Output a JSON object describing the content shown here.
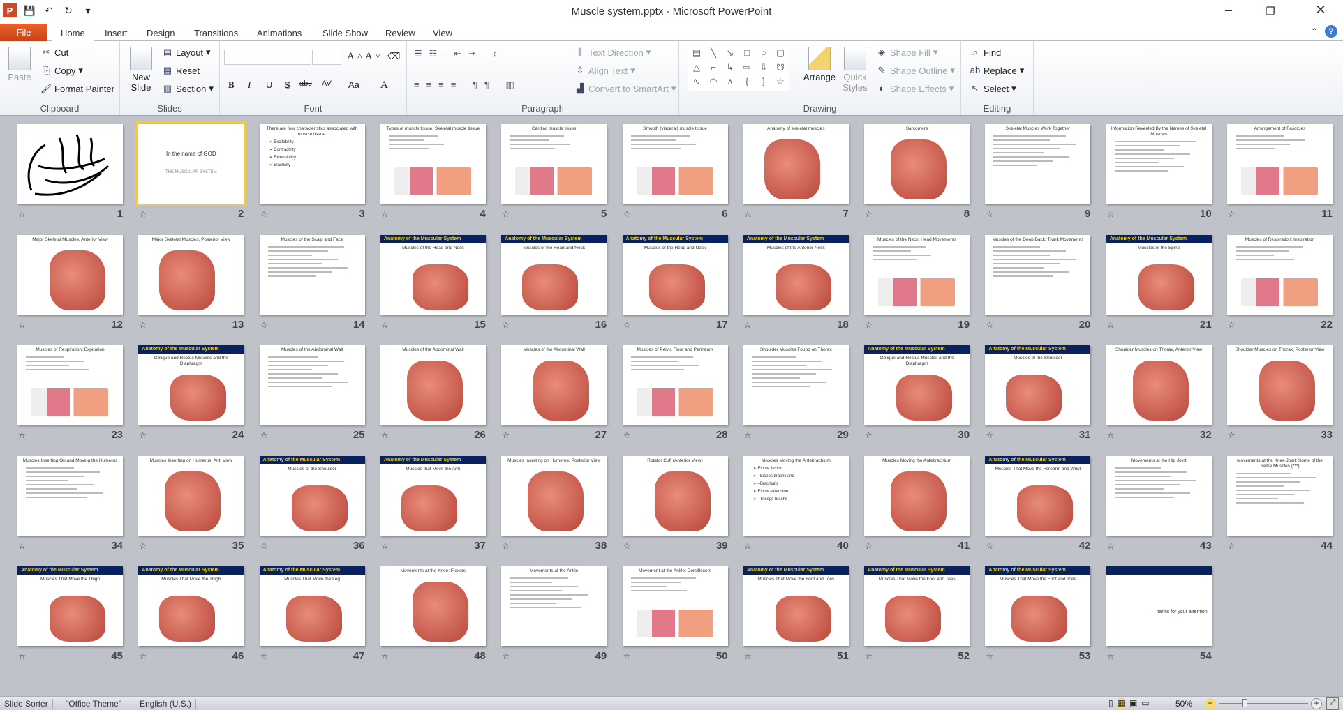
{
  "window": {
    "title": "Muscle system.pptx - Microsoft PowerPoint",
    "minimize": "–",
    "restore": "❐",
    "close": "✕"
  },
  "quick_access": [
    {
      "icon": "powerpoint-logo-icon",
      "glyph": "P"
    },
    {
      "icon": "save-icon",
      "glyph": "💾"
    },
    {
      "icon": "undo-icon",
      "glyph": "↶"
    },
    {
      "icon": "redo-icon",
      "glyph": "↻"
    },
    {
      "icon": "customize-icon",
      "glyph": "▾"
    }
  ],
  "tabs": [
    "File",
    "Home",
    "Insert",
    "Design",
    "Transitions",
    "Animations",
    "Slide Show",
    "Review",
    "View"
  ],
  "active_tab": "Home",
  "ribbon": {
    "clipboard": {
      "label": "Clipboard",
      "paste": "Paste",
      "cut": "Cut",
      "copy": "Copy",
      "format_painter": "Format Painter"
    },
    "slides": {
      "label": "Slides",
      "new_slide": "New Slide",
      "layout": "Layout",
      "reset": "Reset",
      "section": "Section"
    },
    "font": {
      "label": "Font",
      "font_name": "",
      "font_size": "",
      "bold": "B",
      "italic": "I",
      "underline": "U",
      "shadow": "S",
      "strike": "abc",
      "spacing": "AV",
      "case": "Aa",
      "color": "A"
    },
    "paragraph": {
      "label": "Paragraph",
      "text_direction": "Text Direction",
      "align_text": "Align Text",
      "convert_smartart": "Convert to SmartArt"
    },
    "drawing": {
      "label": "Drawing",
      "arrange": "Arrange",
      "quick_styles": "Quick Styles",
      "shape_fill": "Shape Fill",
      "shape_outline": "Shape Outline",
      "shape_effects": "Shape Effects",
      "shapes": [
        "▤",
        "╲",
        "↘",
        "□",
        "○",
        "▢",
        "△",
        "⌐",
        "↳",
        "⇨",
        "⇩",
        "☋",
        "∿",
        "◠",
        "∧",
        "{",
        "}",
        "☆"
      ]
    },
    "editing": {
      "label": "Editing",
      "find": "Find",
      "replace": "Replace",
      "select": "Select"
    }
  },
  "slides": [
    {
      "n": "1",
      "kind": "calligraphy",
      "logo_text": "بسم الله الرحمن الرحيم"
    },
    {
      "n": "2",
      "title": "In the name of GOD",
      "subtitle": "THE MUSCULAR SYSTEM",
      "kind": "title",
      "selected": true
    },
    {
      "n": "3",
      "title": "There are four characteristics associated with muscle tissue:",
      "bullets": [
        "Excitability",
        "Contractility",
        "Extensibility",
        "Elasticity"
      ],
      "kind": "text"
    },
    {
      "n": "4",
      "title": "Types of muscle tissue: Skeletal muscle tissue",
      "kind": "mixed"
    },
    {
      "n": "5",
      "title": "Cardiac muscle tissue",
      "kind": "mixed"
    },
    {
      "n": "6",
      "title": "Smooth (visceral) muscle tissue",
      "kind": "mixed"
    },
    {
      "n": "7",
      "title": "Anatomy of skeletal muscles",
      "kind": "figure"
    },
    {
      "n": "8",
      "title": "Sarcomere",
      "kind": "figure"
    },
    {
      "n": "9",
      "title": "Skeletal Muscles Work Together",
      "kind": "text"
    },
    {
      "n": "10",
      "title": "Information Revealed By the Names of Skeletal Muscles",
      "kind": "text"
    },
    {
      "n": "11",
      "title": "Arrangement of Fascicles",
      "kind": "mixed"
    },
    {
      "n": "12",
      "title": "Major Skeletal Muscles, Anterior View",
      "kind": "figure"
    },
    {
      "n": "13",
      "title": "Major Skeletal Muscles, Posterior View",
      "kind": "figure"
    },
    {
      "n": "14",
      "title": "Muscles of the Scalp and Face",
      "kind": "text"
    },
    {
      "n": "15",
      "header": "Anatomy of the Muscular System",
      "title": "Muscles of the Head and Neck",
      "kind": "figure"
    },
    {
      "n": "16",
      "header": "Anatomy of the Muscular System",
      "title": "Muscles of the Head and Neck",
      "kind": "figure"
    },
    {
      "n": "17",
      "header": "Anatomy of the Muscular System",
      "title": "Muscles of the Head and Neck",
      "kind": "figure"
    },
    {
      "n": "18",
      "header": "Anatomy of the Muscular System",
      "title": "Muscles of the Anterior Neck",
      "kind": "figure"
    },
    {
      "n": "19",
      "title": "Muscles of the Neck: Head Movements",
      "kind": "mixed"
    },
    {
      "n": "20",
      "title": "Muscles of the Deep Back: Trunk Movements",
      "kind": "text"
    },
    {
      "n": "21",
      "header": "Anatomy of the Muscular System",
      "title": "Muscles of the Spine",
      "kind": "figure"
    },
    {
      "n": "22",
      "title": "Muscles of Respiration: Inspiration",
      "kind": "mixed"
    },
    {
      "n": "23",
      "title": "Muscles of Respiration: Expiration",
      "kind": "mixed"
    },
    {
      "n": "24",
      "header": "Anatomy of the Muscular System",
      "title": "Oblique and Rectus Muscles and the Diaphragm",
      "kind": "figure"
    },
    {
      "n": "25",
      "title": "Muscles of the Abdominal Wall",
      "kind": "text"
    },
    {
      "n": "26",
      "title": "Muscles of the Abdominal Wall",
      "kind": "figure"
    },
    {
      "n": "27",
      "title": "Muscles of the Abdominal Wall",
      "kind": "figure"
    },
    {
      "n": "28",
      "title": "Muscles of Pelvic Floor and Perineum",
      "kind": "mixed"
    },
    {
      "n": "29",
      "title": "Shoulder Muscles Found on Thorax",
      "kind": "text"
    },
    {
      "n": "30",
      "header": "Anatomy of the Muscular System",
      "title": "Oblique and Rectus Muscles and the Diaphragm",
      "kind": "figure"
    },
    {
      "n": "31",
      "header": "Anatomy of the Muscular System",
      "title": "Muscles of the Shoulder",
      "kind": "figure"
    },
    {
      "n": "32",
      "title": "Shoulder Muscles on Thorax, Anterior View",
      "kind": "figure"
    },
    {
      "n": "33",
      "title": "Shoulder Muscles on Thorax, Posterior View",
      "kind": "figure"
    },
    {
      "n": "34",
      "title": "Muscles Inserting On and Moving the Humerus",
      "kind": "text"
    },
    {
      "n": "35",
      "title": "Muscles Inserting on Humerus, Ant. View",
      "kind": "figure"
    },
    {
      "n": "36",
      "header": "Anatomy of the Muscular System",
      "title": "Muscles of the Shoulder",
      "kind": "figure"
    },
    {
      "n": "37",
      "header": "Anatomy of the Muscular System",
      "title": "Muscles that Move the Arm",
      "kind": "figure"
    },
    {
      "n": "38",
      "title": "Muscles Inserting on Humerus, Posterior View",
      "kind": "figure"
    },
    {
      "n": "39",
      "title": "Rotator Cuff (Anterior View)",
      "kind": "figure"
    },
    {
      "n": "40",
      "title": "Muscles Moving the Antebrachium",
      "bullets": [
        "Elbow flexion",
        "–Biceps brachii and",
        "–Brachialis",
        "Elbow extension",
        "–Triceps brachii"
      ],
      "kind": "text"
    },
    {
      "n": "41",
      "title": "Muscles Moving the Antebrachium",
      "kind": "figure"
    },
    {
      "n": "42",
      "header": "Anatomy of the Muscular System",
      "title": "Muscles That Move the Forearm and Wrist",
      "kind": "figure"
    },
    {
      "n": "43",
      "title": "Movements at the Hip Joint",
      "kind": "text"
    },
    {
      "n": "44",
      "title": "Movements at the Knee Joint: Some of the Same Muscles (***)",
      "kind": "text"
    },
    {
      "n": "45",
      "header": "Anatomy of the Muscular System",
      "title": "Muscles That Move the Thigh",
      "kind": "figure"
    },
    {
      "n": "46",
      "header": "Anatomy of the Muscular System",
      "title": "Muscles That Move the Thigh",
      "kind": "figure"
    },
    {
      "n": "47",
      "header": "Anatomy of the Muscular System",
      "title": "Muscles That Move the Leg",
      "kind": "figure"
    },
    {
      "n": "48",
      "title": "Movements at the Knee: Flexors",
      "kind": "figure"
    },
    {
      "n": "49",
      "title": "Movements at the Ankle",
      "kind": "text"
    },
    {
      "n": "50",
      "title": "Movement at the Ankle: Dorsiflexors",
      "kind": "mixed"
    },
    {
      "n": "51",
      "header": "Anatomy of the Muscular System",
      "title": "Muscles That Move the Foot and Toes",
      "kind": "figure"
    },
    {
      "n": "52",
      "header": "Anatomy of the Muscular System",
      "title": "Muscles That Move the Foot and Toes",
      "kind": "figure"
    },
    {
      "n": "53",
      "header": "Anatomy of the Muscular System",
      "title": "Muscles That Move the Foot and Toes",
      "kind": "figure"
    },
    {
      "n": "54",
      "header": " ",
      "title": "",
      "body": "Thanks for your attention",
      "kind": "end"
    }
  ],
  "statusbar": {
    "view": "Slide Sorter",
    "theme": "\"Office Theme\"",
    "language": "English (U.S.)",
    "zoom": "50%",
    "zoom_percent": 50
  },
  "colors": {
    "header_bar": "#0a2160",
    "header_text": "#f3d000",
    "selection": "#f3c845",
    "file_tab": "#d9531e"
  }
}
